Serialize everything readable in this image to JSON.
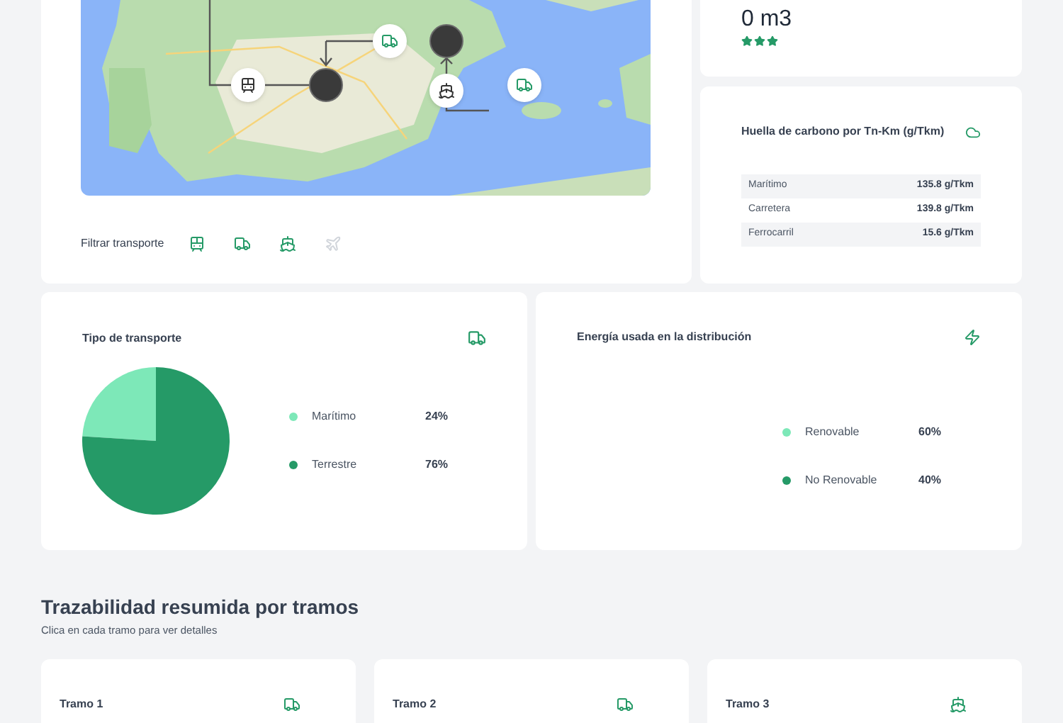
{
  "map": {
    "markers": [
      {
        "kind": "train"
      },
      {
        "kind": "avatar"
      },
      {
        "kind": "truck"
      },
      {
        "kind": "avatar"
      },
      {
        "kind": "ship"
      },
      {
        "kind": "truck"
      }
    ]
  },
  "filter": {
    "label": "Filtrar transporte",
    "items": [
      {
        "kind": "train",
        "selected": true
      },
      {
        "kind": "truck",
        "selected": true
      },
      {
        "kind": "ship",
        "selected": true
      },
      {
        "kind": "plane",
        "selected": false
      }
    ]
  },
  "volume": {
    "value": "0 m3",
    "stars": 3
  },
  "carbon": {
    "title": "Huella de carbono por Tn-Km (g/Tkm)",
    "rows": [
      {
        "mode": "Marítimo",
        "value": "135.8 g/Tkm"
      },
      {
        "mode": "Carretera",
        "value": "139.8 g/Tkm"
      },
      {
        "mode": "Ferrocarril",
        "value": "15.6 g/Tkm"
      }
    ]
  },
  "transport_type": {
    "title": "Tipo de transporte",
    "chart_data": {
      "type": "pie",
      "categories": [
        "Marítimo",
        "Terrestre"
      ],
      "values": [
        24,
        76
      ]
    },
    "legend": [
      {
        "value": "24%",
        "color": "#7de8b8"
      },
      {
        "value": "76%",
        "color": "#259a67"
      }
    ]
  },
  "energy": {
    "title": "Energía usada en la distribución",
    "legend": [
      {
        "label": "Renovable",
        "value": "60%",
        "color": "#7de8b8"
      },
      {
        "label": "No Renovable",
        "value": "40%",
        "color": "#259a67"
      }
    ]
  },
  "tramos": {
    "title": "Trazabilidad resumida por tramos",
    "subtitle": "Clica en cada tramo para ver detalles",
    "cards": [
      {
        "title": "Tramo 1",
        "kind": "truck"
      },
      {
        "title": "Tramo 2",
        "kind": "truck"
      },
      {
        "title": "Tramo 3",
        "kind": "ship"
      }
    ]
  }
}
